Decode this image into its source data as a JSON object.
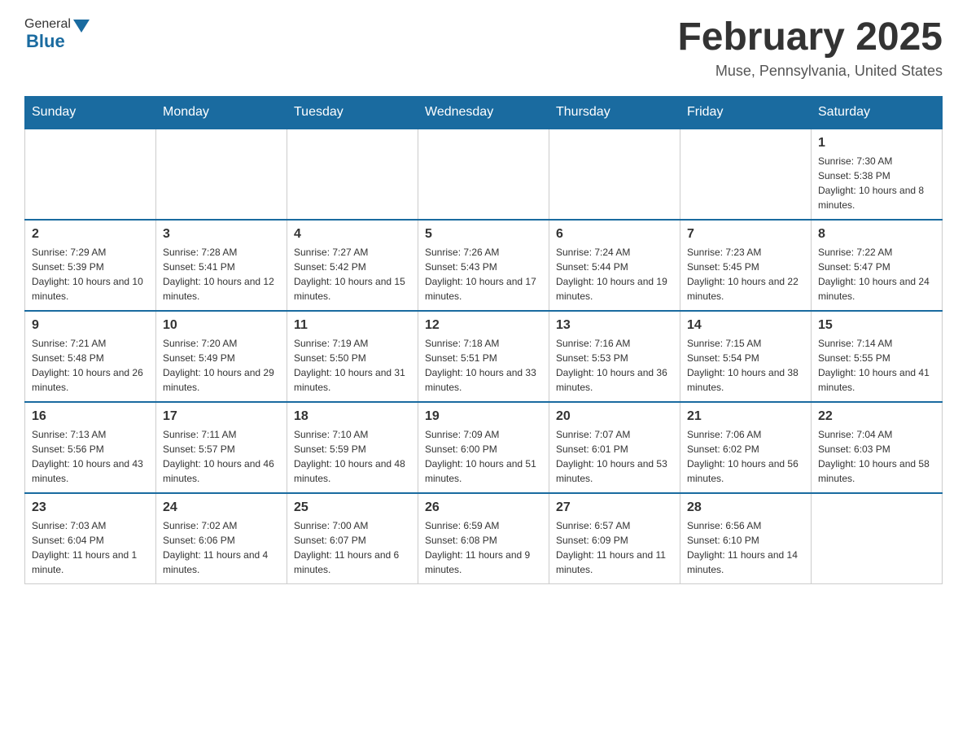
{
  "header": {
    "logo_general": "General",
    "logo_blue": "Blue",
    "month_title": "February 2025",
    "location": "Muse, Pennsylvania, United States"
  },
  "days_of_week": [
    "Sunday",
    "Monday",
    "Tuesday",
    "Wednesday",
    "Thursday",
    "Friday",
    "Saturday"
  ],
  "weeks": [
    [
      {
        "day": "",
        "sunrise": "",
        "sunset": "",
        "daylight": ""
      },
      {
        "day": "",
        "sunrise": "",
        "sunset": "",
        "daylight": ""
      },
      {
        "day": "",
        "sunrise": "",
        "sunset": "",
        "daylight": ""
      },
      {
        "day": "",
        "sunrise": "",
        "sunset": "",
        "daylight": ""
      },
      {
        "day": "",
        "sunrise": "",
        "sunset": "",
        "daylight": ""
      },
      {
        "day": "",
        "sunrise": "",
        "sunset": "",
        "daylight": ""
      },
      {
        "day": "1",
        "sunrise": "Sunrise: 7:30 AM",
        "sunset": "Sunset: 5:38 PM",
        "daylight": "Daylight: 10 hours and 8 minutes."
      }
    ],
    [
      {
        "day": "2",
        "sunrise": "Sunrise: 7:29 AM",
        "sunset": "Sunset: 5:39 PM",
        "daylight": "Daylight: 10 hours and 10 minutes."
      },
      {
        "day": "3",
        "sunrise": "Sunrise: 7:28 AM",
        "sunset": "Sunset: 5:41 PM",
        "daylight": "Daylight: 10 hours and 12 minutes."
      },
      {
        "day": "4",
        "sunrise": "Sunrise: 7:27 AM",
        "sunset": "Sunset: 5:42 PM",
        "daylight": "Daylight: 10 hours and 15 minutes."
      },
      {
        "day": "5",
        "sunrise": "Sunrise: 7:26 AM",
        "sunset": "Sunset: 5:43 PM",
        "daylight": "Daylight: 10 hours and 17 minutes."
      },
      {
        "day": "6",
        "sunrise": "Sunrise: 7:24 AM",
        "sunset": "Sunset: 5:44 PM",
        "daylight": "Daylight: 10 hours and 19 minutes."
      },
      {
        "day": "7",
        "sunrise": "Sunrise: 7:23 AM",
        "sunset": "Sunset: 5:45 PM",
        "daylight": "Daylight: 10 hours and 22 minutes."
      },
      {
        "day": "8",
        "sunrise": "Sunrise: 7:22 AM",
        "sunset": "Sunset: 5:47 PM",
        "daylight": "Daylight: 10 hours and 24 minutes."
      }
    ],
    [
      {
        "day": "9",
        "sunrise": "Sunrise: 7:21 AM",
        "sunset": "Sunset: 5:48 PM",
        "daylight": "Daylight: 10 hours and 26 minutes."
      },
      {
        "day": "10",
        "sunrise": "Sunrise: 7:20 AM",
        "sunset": "Sunset: 5:49 PM",
        "daylight": "Daylight: 10 hours and 29 minutes."
      },
      {
        "day": "11",
        "sunrise": "Sunrise: 7:19 AM",
        "sunset": "Sunset: 5:50 PM",
        "daylight": "Daylight: 10 hours and 31 minutes."
      },
      {
        "day": "12",
        "sunrise": "Sunrise: 7:18 AM",
        "sunset": "Sunset: 5:51 PM",
        "daylight": "Daylight: 10 hours and 33 minutes."
      },
      {
        "day": "13",
        "sunrise": "Sunrise: 7:16 AM",
        "sunset": "Sunset: 5:53 PM",
        "daylight": "Daylight: 10 hours and 36 minutes."
      },
      {
        "day": "14",
        "sunrise": "Sunrise: 7:15 AM",
        "sunset": "Sunset: 5:54 PM",
        "daylight": "Daylight: 10 hours and 38 minutes."
      },
      {
        "day": "15",
        "sunrise": "Sunrise: 7:14 AM",
        "sunset": "Sunset: 5:55 PM",
        "daylight": "Daylight: 10 hours and 41 minutes."
      }
    ],
    [
      {
        "day": "16",
        "sunrise": "Sunrise: 7:13 AM",
        "sunset": "Sunset: 5:56 PM",
        "daylight": "Daylight: 10 hours and 43 minutes."
      },
      {
        "day": "17",
        "sunrise": "Sunrise: 7:11 AM",
        "sunset": "Sunset: 5:57 PM",
        "daylight": "Daylight: 10 hours and 46 minutes."
      },
      {
        "day": "18",
        "sunrise": "Sunrise: 7:10 AM",
        "sunset": "Sunset: 5:59 PM",
        "daylight": "Daylight: 10 hours and 48 minutes."
      },
      {
        "day": "19",
        "sunrise": "Sunrise: 7:09 AM",
        "sunset": "Sunset: 6:00 PM",
        "daylight": "Daylight: 10 hours and 51 minutes."
      },
      {
        "day": "20",
        "sunrise": "Sunrise: 7:07 AM",
        "sunset": "Sunset: 6:01 PM",
        "daylight": "Daylight: 10 hours and 53 minutes."
      },
      {
        "day": "21",
        "sunrise": "Sunrise: 7:06 AM",
        "sunset": "Sunset: 6:02 PM",
        "daylight": "Daylight: 10 hours and 56 minutes."
      },
      {
        "day": "22",
        "sunrise": "Sunrise: 7:04 AM",
        "sunset": "Sunset: 6:03 PM",
        "daylight": "Daylight: 10 hours and 58 minutes."
      }
    ],
    [
      {
        "day": "23",
        "sunrise": "Sunrise: 7:03 AM",
        "sunset": "Sunset: 6:04 PM",
        "daylight": "Daylight: 11 hours and 1 minute."
      },
      {
        "day": "24",
        "sunrise": "Sunrise: 7:02 AM",
        "sunset": "Sunset: 6:06 PM",
        "daylight": "Daylight: 11 hours and 4 minutes."
      },
      {
        "day": "25",
        "sunrise": "Sunrise: 7:00 AM",
        "sunset": "Sunset: 6:07 PM",
        "daylight": "Daylight: 11 hours and 6 minutes."
      },
      {
        "day": "26",
        "sunrise": "Sunrise: 6:59 AM",
        "sunset": "Sunset: 6:08 PM",
        "daylight": "Daylight: 11 hours and 9 minutes."
      },
      {
        "day": "27",
        "sunrise": "Sunrise: 6:57 AM",
        "sunset": "Sunset: 6:09 PM",
        "daylight": "Daylight: 11 hours and 11 minutes."
      },
      {
        "day": "28",
        "sunrise": "Sunrise: 6:56 AM",
        "sunset": "Sunset: 6:10 PM",
        "daylight": "Daylight: 11 hours and 14 minutes."
      },
      {
        "day": "",
        "sunrise": "",
        "sunset": "",
        "daylight": ""
      }
    ]
  ]
}
